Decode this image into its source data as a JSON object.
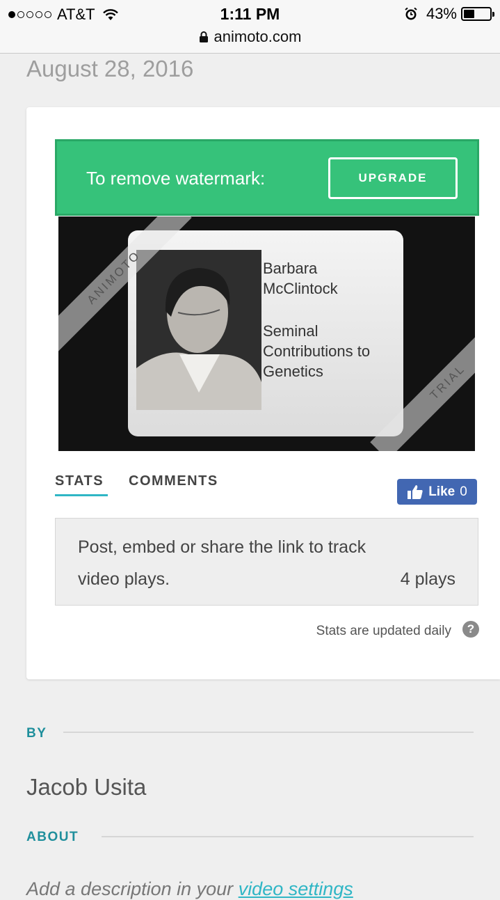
{
  "status": {
    "carrier": "AT&T",
    "time": "1:11 PM",
    "battery": "43%",
    "battery_level": 0.43,
    "url": "animoto.com"
  },
  "page": {
    "date": "August 28, 2016"
  },
  "banner": {
    "text": "To remove watermark:",
    "button": "UPGRADE"
  },
  "video": {
    "watermark_left": "ANIMOTO",
    "watermark_right": "TRIAL",
    "name_line1": "Barbara",
    "name_line2": "McClintock",
    "subtitle_line1": "Seminal",
    "subtitle_line2": "Contributions to",
    "subtitle_line3": "Genetics"
  },
  "tabs": {
    "stats": "STATS",
    "comments": "COMMENTS"
  },
  "like": {
    "label": "Like",
    "count": "0"
  },
  "stats": {
    "message": "Post, embed or share the link to track video plays.",
    "plays": "4 plays",
    "updated": "Stats are updated daily"
  },
  "by": {
    "label": "BY",
    "author": "Jacob Usita"
  },
  "about": {
    "label": "ABOUT",
    "desc_prefix": "Add a description in your ",
    "desc_link": "video settings"
  },
  "colors": {
    "banner_green": "#36c27a",
    "accent_teal": "#1f8f9c",
    "facebook_blue": "#4267b2"
  }
}
